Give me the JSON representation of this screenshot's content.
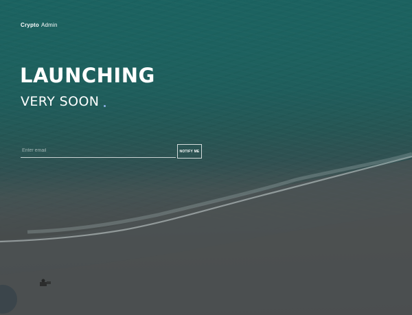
{
  "brand": {
    "bold": "Crypto",
    "light": "Admin"
  },
  "hero": {
    "headline": "LAUNCHING",
    "subline": "VERY SOON"
  },
  "form": {
    "email_placeholder": "Enter email",
    "notify_label": "NOTIFY ME"
  },
  "colors": {
    "accent_dot": "#8fb3e8",
    "water": "#1d6e6b",
    "sand": "#4f5353"
  }
}
